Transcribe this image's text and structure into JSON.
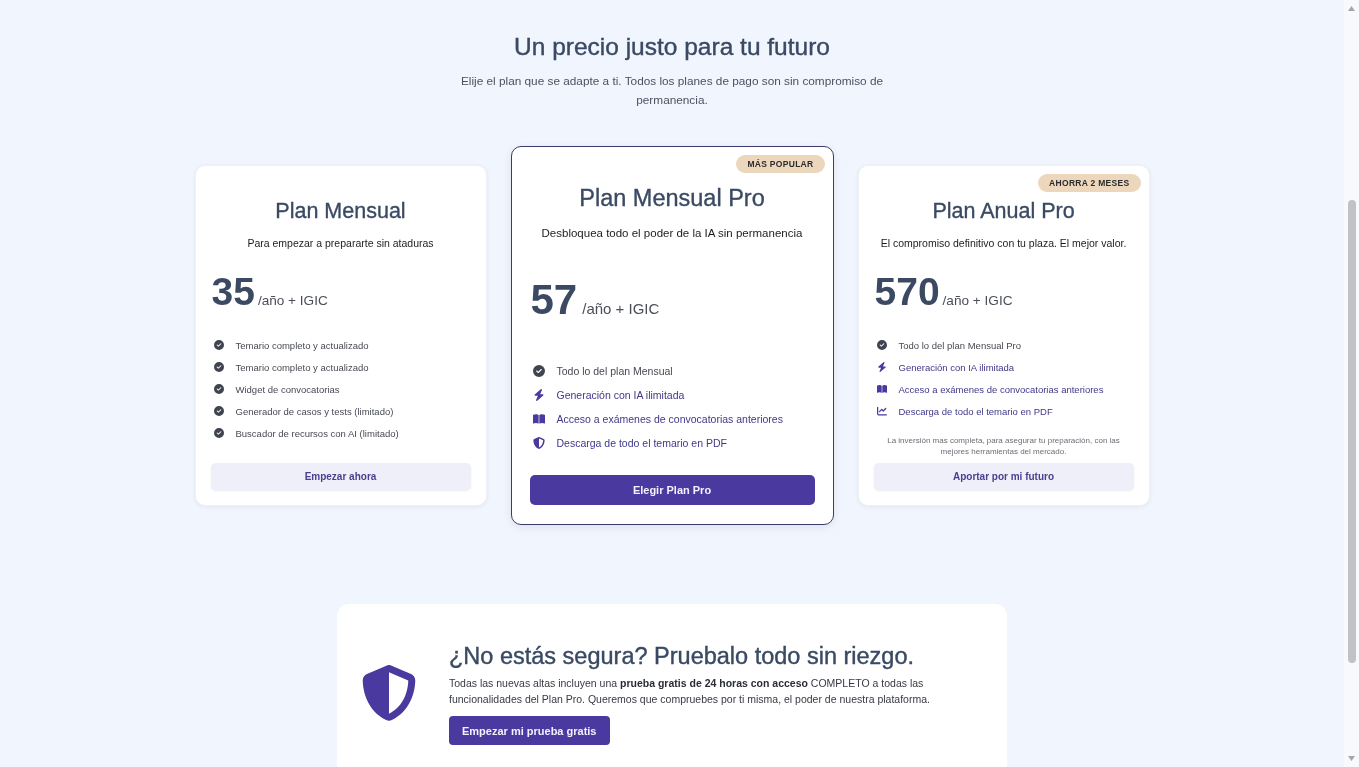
{
  "header": {
    "title": "Un precio justo para tu futuro",
    "subtitle": "Elije el plan que se adapte a ti. Todos los planes de pago son sin compromiso de permanencia."
  },
  "plans": [
    {
      "name": "Plan Mensual",
      "featured": false,
      "description": "Para empezar a prepararte sin ataduras",
      "price": "35",
      "period": "/año + IGIC",
      "features": [
        {
          "kind": "check",
          "text": "Temario completo y actualizado"
        },
        {
          "kind": "check",
          "text": "Temario completo y actualizado"
        },
        {
          "kind": "check",
          "text": "Widget de convocatorias"
        },
        {
          "kind": "check",
          "text": "Generador de casos y tests (limitado)"
        },
        {
          "kind": "check",
          "text": "Buscador de recursos con AI (limitado)"
        }
      ],
      "button": "Empezar ahora"
    },
    {
      "name": "Plan Mensual Pro",
      "featured": true,
      "badge": "MÁS POPULAR",
      "description": "Desbloquea todo el poder de la IA sin permanencia",
      "price": "57",
      "period": "/año + IGIC",
      "features": [
        {
          "kind": "check",
          "text": "Todo lo del plan Mensual"
        },
        {
          "kind": "bolt",
          "text": "Generación con IA ilimitada"
        },
        {
          "kind": "book",
          "text": "Acceso a exámenes de convocatorias anteriores"
        },
        {
          "kind": "shield",
          "text": "Descarga de todo el temario en PDF"
        }
      ],
      "button": "Elegir Plan Pro"
    },
    {
      "name": "Plan Anual Pro",
      "featured": false,
      "badge": "AHORRA 2 MESES",
      "description": "El compromiso definitivo con tu plaza. El mejor valor.",
      "price": "570",
      "period": "/año + IGIC",
      "features": [
        {
          "kind": "check",
          "text": "Todo lo del plan Mensual Pro"
        },
        {
          "kind": "bolt",
          "text": "Generación con IA ilimitada"
        },
        {
          "kind": "book",
          "text": "Acceso a exámenes de convocatorias anteriores"
        },
        {
          "kind": "chart",
          "text": "Descarga de todo el temario en PDF"
        }
      ],
      "note": "La inversión mas completa, para asegurar tu preparación, con las mejores herramientas del mercado.",
      "button": "Aportar por mi futuro"
    }
  ],
  "trial": {
    "title": "¿No estás segura? Pruebalo todo sin riezgo.",
    "text": "Todas las nuevas altas incluyen una **prueba gratis de 24 horas con acceso** COMPLETO a todas las funcionalidades del Plan Pro. Queremos que compruebes por ti misma, el poder de nuestra plataforma.",
    "button": "Empezar mi prueba gratis"
  }
}
